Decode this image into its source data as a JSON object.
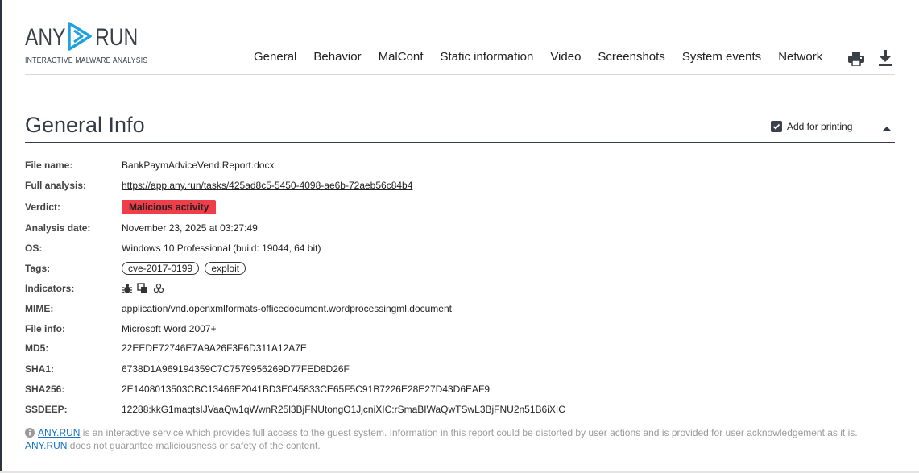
{
  "logo": {
    "word_left": "ANY",
    "word_right": "RUN",
    "subtitle": "INTERACTIVE MALWARE ANALYSIS",
    "accent_color": "#1da1e0"
  },
  "nav": {
    "items": [
      "General",
      "Behavior",
      "MalConf",
      "Static information",
      "Video",
      "Screenshots",
      "System events",
      "Network"
    ],
    "print_icon": "print-icon",
    "download_icon": "download-icon"
  },
  "section": {
    "title": "General Info",
    "add_for_printing": "Add for printing",
    "add_for_printing_checked": true
  },
  "info": {
    "file_name": {
      "label": "File name:",
      "value": "BankPaymAdviceVend.Report.docx"
    },
    "full_analysis": {
      "label": "Full analysis:",
      "value": "https://app.any.run/tasks/425ad8c5-5450-4098-ae6b-72aeb56c84b4"
    },
    "verdict": {
      "label": "Verdict:",
      "value": "Malicious activity",
      "color": "#ef3e4a"
    },
    "analysis_date": {
      "label": "Analysis date:",
      "value": "November 23, 2025 at 03:27:49"
    },
    "os": {
      "label": "OS:",
      "value": "Windows 10 Professional (build: 19044, 64 bit)"
    },
    "tags": {
      "label": "Tags:",
      "values": [
        "cve-2017-0199",
        "exploit"
      ]
    },
    "indicators": {
      "label": "Indicators:",
      "icons": [
        "bug-icon",
        "copy-icon",
        "biohazard-icon"
      ]
    },
    "mime": {
      "label": "MIME:",
      "value": "application/vnd.openxmlformats-officedocument.wordprocessingml.document"
    },
    "file_info": {
      "label": "File info:",
      "value": "Microsoft Word 2007+"
    },
    "md5": {
      "label": "MD5:",
      "value": "22EEDE72746E7A9A26F3F6D311A12A7E"
    },
    "sha1": {
      "label": "SHA1:",
      "value": "6738D1A969194359C7C7579956269D77FED8D26F"
    },
    "sha256": {
      "label": "SHA256:",
      "value": "2E1408013503CBC13466E2041BD3E045833CE65F5C91B7226E28E27D43D6EAF9"
    },
    "ssdeep": {
      "label": "SSDEEP:",
      "value": "12288:kkG1maqtsIJVaaQw1qWwnR25l3BjFNUtongO1JjcniXIC:rSmaBIWaQwTSwL3BjFNU2n51B6iXIC"
    }
  },
  "note": {
    "link1": "ANY.RUN",
    "text1": " is an interactive service which provides full access to the guest system. Information in this report could be distorted by user actions and is provided for user acknowledgement as it is.",
    "link2": "ANY.RUN",
    "text2": " does not guarantee maliciousness or safety of the content."
  }
}
